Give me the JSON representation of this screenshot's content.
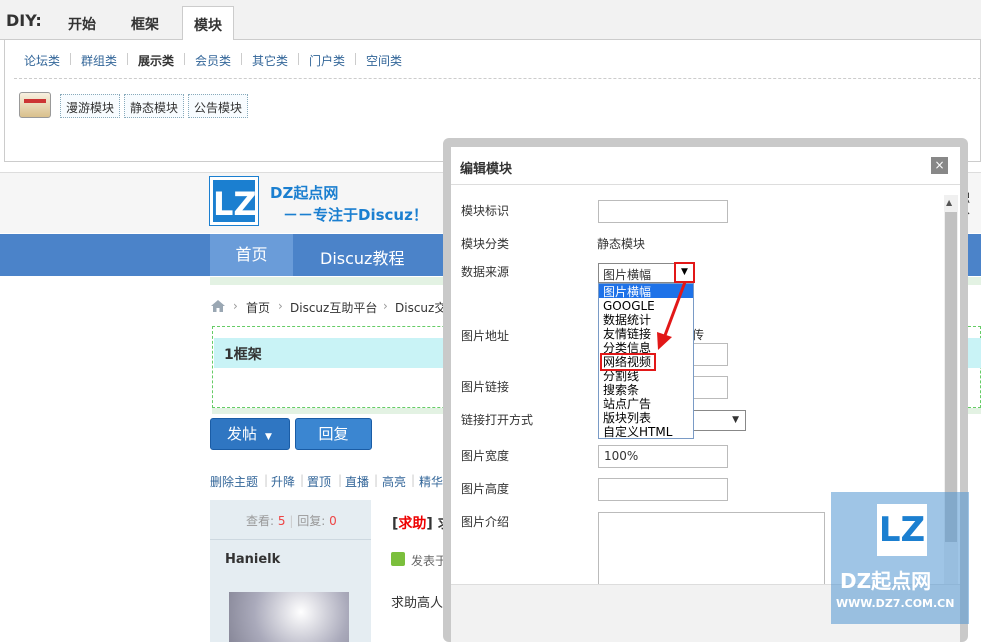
{
  "diy": {
    "label": "DIY:",
    "tabs": [
      "开始",
      "框架",
      "模块"
    ],
    "categories": [
      "论坛类",
      "群组类",
      "展示类",
      "会员类",
      "其它类",
      "门户类",
      "空间类"
    ],
    "modules": [
      "漫游模块",
      "静态模块",
      "公告模块"
    ]
  },
  "page": {
    "logo_mark": "LZ",
    "logo_title": "DZ起点网",
    "logo_slogan": "－－专注于Discuz！",
    "right_fragment": "积分",
    "nav": [
      "首页",
      "Discuz教程"
    ],
    "breadcrumb": [
      "首页",
      "Discuz互助平台",
      "Discuz交流"
    ],
    "frame_title": "1框架",
    "post_button": "发帖",
    "reply_button": "回复",
    "actions": [
      "删除主题",
      "升降",
      "置顶",
      "直播",
      "高亮",
      "精华"
    ],
    "stats_views_label": "查看:",
    "stats_views": "5",
    "stats_replies_label": "回复:",
    "stats_replies": "0",
    "author": "Hanielk",
    "post_tag": "求助",
    "post_title_fragment": "求",
    "post_meta": "发表于",
    "post_body": "求助高人"
  },
  "dialog": {
    "title": "编辑模块",
    "close_glyph": "×",
    "labels": {
      "module_id": "模块标识",
      "module_category": "模块分类",
      "data_source": "数据来源",
      "image_url": "图片地址",
      "image_link": "图片链接",
      "link_open": "链接打开方式",
      "image_width": "图片宽度",
      "image_height": "图片高度",
      "image_intro": "图片介绍"
    },
    "category_value": "静态模块",
    "source_selected": "图片横幅",
    "source_options": [
      "图片横幅",
      "GOOGLE",
      "数据统计",
      "友情链接",
      "分类信息",
      "网络视频",
      "分割线",
      "搜索条",
      "站点广告",
      "版块列表",
      "自定义HTML"
    ],
    "image_url_fragment": "传",
    "width_value": "100%",
    "highlighted_option": "网络视频"
  },
  "watermark": {
    "mark": "LZ",
    "title": "DZ起点网",
    "url": "WWW.DZ7.COM.CN"
  },
  "colors": {
    "nav_blue": "#4b83c9",
    "brand_blue": "#1b7fd0",
    "highlight_red": "#e21818",
    "select_blue": "#1e72e8"
  }
}
